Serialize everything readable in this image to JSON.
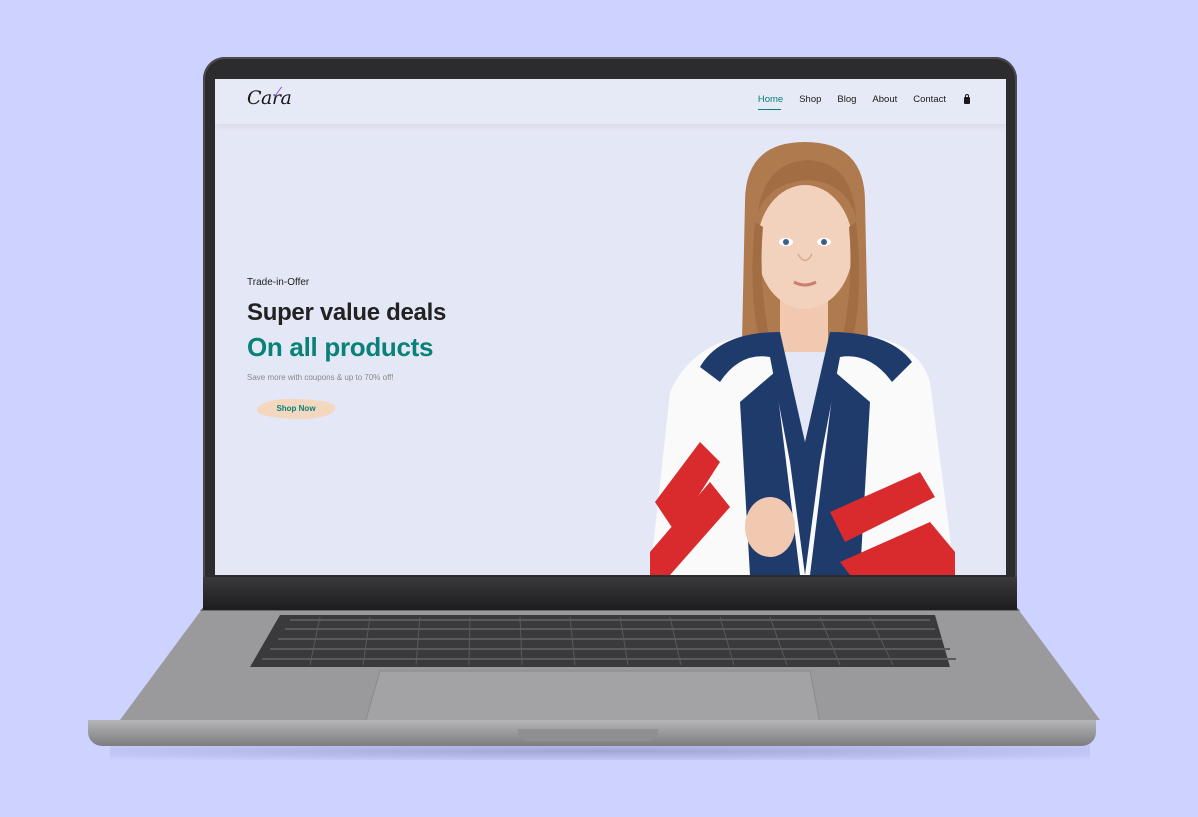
{
  "site": {
    "logo": "Cara",
    "nav": [
      "Home",
      "Shop",
      "Blog",
      "About",
      "Contact"
    ],
    "active_nav": "Home",
    "cart_icon": "shopping-bag-icon"
  },
  "hero": {
    "tagline": "Trade-in-Offer",
    "headline1": "Super value deals",
    "headline2": "On all products",
    "subtext": "Save more with coupons & up to 70% off!",
    "cta": "Shop Now"
  },
  "colors": {
    "page_bg": "#cdd2ff",
    "accent": "#088178",
    "hero_bg": "#e4e7f5",
    "button_bg": "#f3d7bf"
  }
}
